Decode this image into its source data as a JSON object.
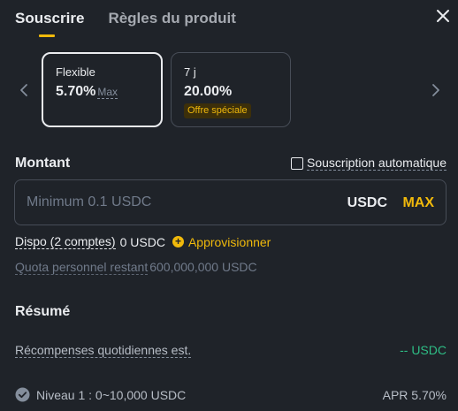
{
  "header": {
    "tabs": [
      {
        "label": "Souscrire",
        "active": true
      },
      {
        "label": "Règles du produit",
        "active": false
      }
    ],
    "close_icon": "close-icon"
  },
  "products": [
    {
      "name": "Flexible",
      "rate": "5.70%",
      "suffix": "Max",
      "selected": true
    },
    {
      "name": "7 j",
      "rate": "20.00%",
      "badge": "Offre spéciale",
      "selected": false
    }
  ],
  "amount": {
    "label": "Montant",
    "auto_label": "Souscription automatique",
    "auto_checked": false,
    "placeholder": "Minimum 0.1 USDC",
    "unit": "USDC",
    "max_label": "MAX"
  },
  "available": {
    "label": "Dispo (2 comptes)",
    "value": "0 USDC",
    "topup_label": "Approvisionner"
  },
  "quota": {
    "label": "Quota personnel restant",
    "value": "600,000,000 USDC"
  },
  "summary": {
    "title": "Résumé",
    "daily_label": "Récompenses quotidiennes est.",
    "daily_value": "-- USDC",
    "tier_label": "Niveau 1 : 0~10,000 USDC",
    "apr_label": "APR 5.70%"
  },
  "colors": {
    "background": "#1f2329",
    "accent": "#f0b90b",
    "positive": "#2ebd85",
    "text": "#eaecef",
    "muted": "#707a8a"
  }
}
